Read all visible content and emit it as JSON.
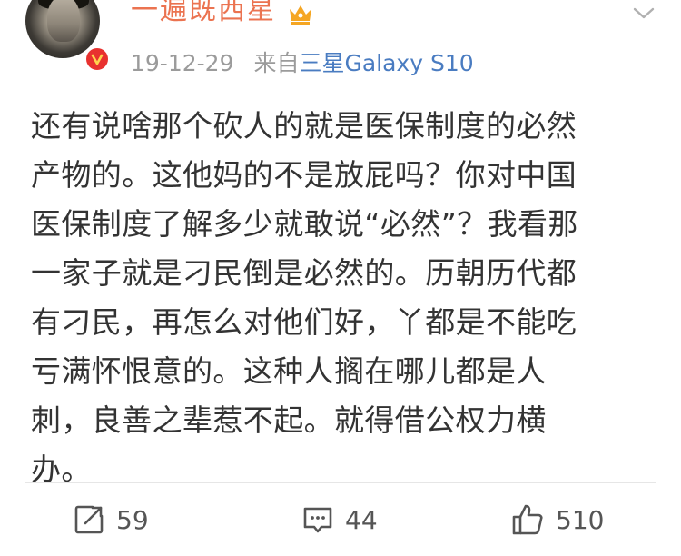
{
  "header": {
    "username": "一遍既西星",
    "timestamp": "19-12-29",
    "source_prefix": "来自",
    "device": "三星Galaxy S10",
    "icons": [
      "avatar",
      "verified-badge-icon",
      "crown-icon",
      "chevron-down-icon"
    ]
  },
  "post": {
    "text": "还有说啥那个砍人的就是医保制度的必然\n产物的。这他妈的不是放屁吗？你对中国\n医保制度了解多少就敢说“必然”？我看那\n一家子就是刁民倒是必然的。历朝历代都\n有刁民，再怎么对他们好，丫都是不能吃\n亏满怀恨意的。这种人搁在哪儿都是人\n刺，良善之辈惹不起。就得借公权力横\n办。"
  },
  "actions": {
    "repost_count": "59",
    "comment_count": "44",
    "like_count": "510"
  },
  "colors": {
    "username": "#eb7350",
    "device_link": "#4a7cc1",
    "meta": "#9b9b9b",
    "badge": "#e8312f",
    "crown": "#f5a623"
  }
}
